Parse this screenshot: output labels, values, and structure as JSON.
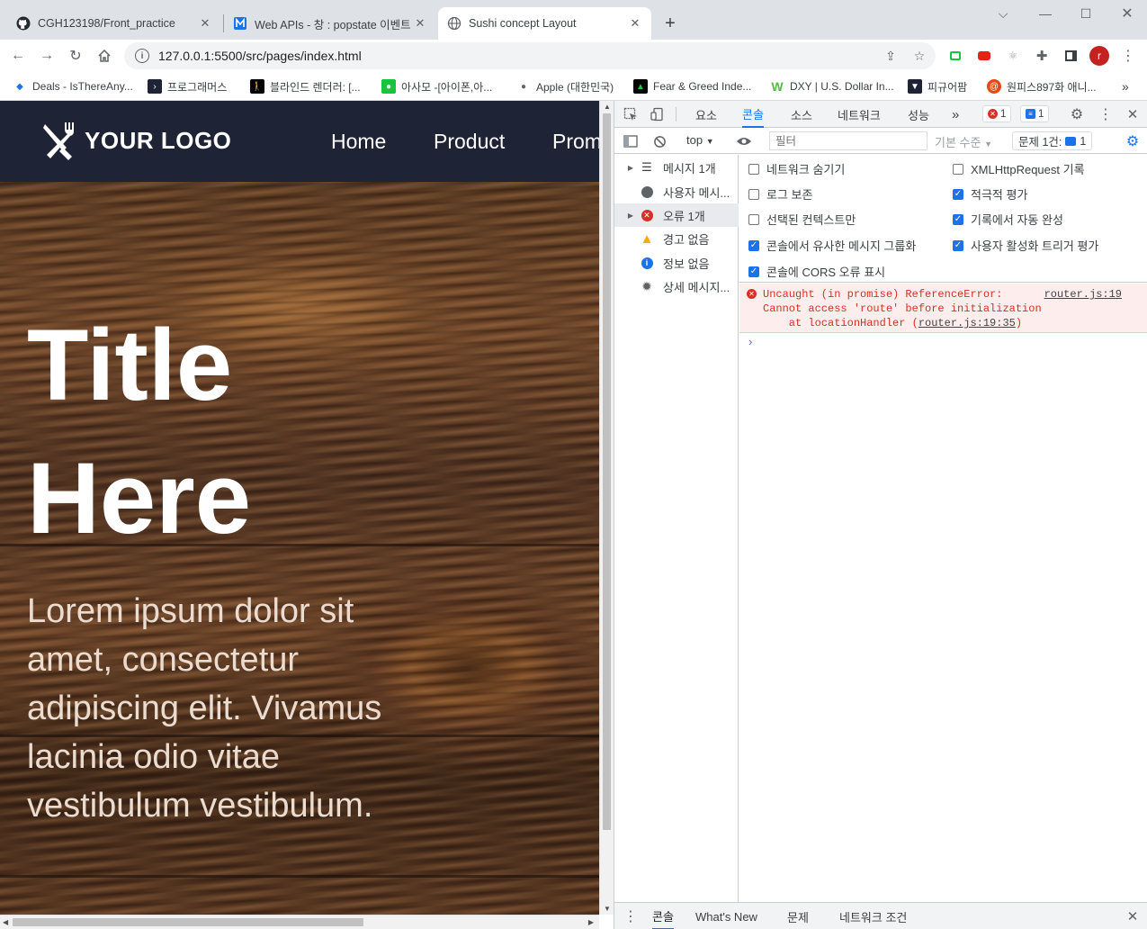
{
  "browser": {
    "tabs": [
      {
        "title": "CGH123198/Front_practice",
        "icon": "github-icon"
      },
      {
        "title": "Web APIs - 창 : popstate 이벤트",
        "icon": "mdn-icon"
      },
      {
        "title": "Sushi concept Layout",
        "icon": "globe-icon"
      }
    ],
    "new_tab": "+",
    "url": "127.0.0.1:5500/src/pages/index.html",
    "profile_initial": "r",
    "bookmarks": [
      {
        "label": "Deals - IsThereAny...",
        "color": "#1a73e8"
      },
      {
        "label": "프로그래머스",
        "color": "#1f2336"
      },
      {
        "label": "블라인드 렌더러: [...",
        "color": "#000000"
      },
      {
        "label": "아사모 -[아이폰,아...",
        "color": "#19c43d"
      },
      {
        "label": "Apple (대한민국)",
        "color": "#555555"
      },
      {
        "label": "Fear & Greed Inde...",
        "color": "#0a7a3d"
      },
      {
        "label": "DXY | U.S. Dollar In...",
        "color": "#58b947"
      },
      {
        "label": "피규어팜",
        "color": "#1f2336"
      },
      {
        "label": "원피스897화 애니...",
        "color": "#e8490f"
      }
    ],
    "more_bookmarks": "»"
  },
  "site": {
    "logo_text": "YOUR LOGO",
    "nav": [
      "Home",
      "Product",
      "Prom"
    ],
    "hero_title_line1": "Title",
    "hero_title_line2": "Here",
    "hero_text": "Lorem ipsum dolor sit amet, consectetur adipiscing elit. Vivamus lacinia odio vitae vestibulum vestibulum."
  },
  "devtools": {
    "tabs": [
      "요소",
      "콘솔",
      "소스",
      "네트워크",
      "성능"
    ],
    "active_tab": "콘솔",
    "more": "»",
    "error_count": "1",
    "message_count": "1",
    "context": "top",
    "filter_placeholder": "필터",
    "level": "기본 수준",
    "issues": "문제 1건:",
    "issues_count": "1",
    "sidebar": [
      {
        "label": "메시지 1개",
        "icon": "list-icon"
      },
      {
        "label": "사용자 메시...",
        "icon": "user-icon"
      },
      {
        "label": "오류 1개",
        "icon": "error-icon"
      },
      {
        "label": "경고 없음",
        "icon": "warning-icon"
      },
      {
        "label": "정보 없음",
        "icon": "info-icon"
      },
      {
        "label": "상세 메시지...",
        "icon": "bug-icon"
      }
    ],
    "settings": {
      "hide_network": "네트워크 숨기기",
      "preserve_log": "로그 보존",
      "selected_context": "선택된 컨텍스트만",
      "group_similar": "콘솔에서 유사한 메시지 그룹화",
      "show_cors": "콘솔에 CORS 오류 표시",
      "log_xhr": "XMLHttpRequest 기록",
      "eager_eval": "적극적 평가",
      "autocomplete": "기록에서 자동 완성",
      "user_activation": "사용자 활성화 트리거 평가"
    },
    "error": {
      "line1": "Uncaught (in promise) ReferenceError:",
      "line2": "Cannot access 'route' before initialization",
      "line3_prefix": "    at locationHandler (",
      "line3_link": "router.js:19:35",
      "line3_suffix": ")",
      "source": "router.js:19"
    },
    "prompt": "›",
    "drawer": [
      "콘솔",
      "What's New",
      "문제",
      "네트워크 조건"
    ]
  }
}
